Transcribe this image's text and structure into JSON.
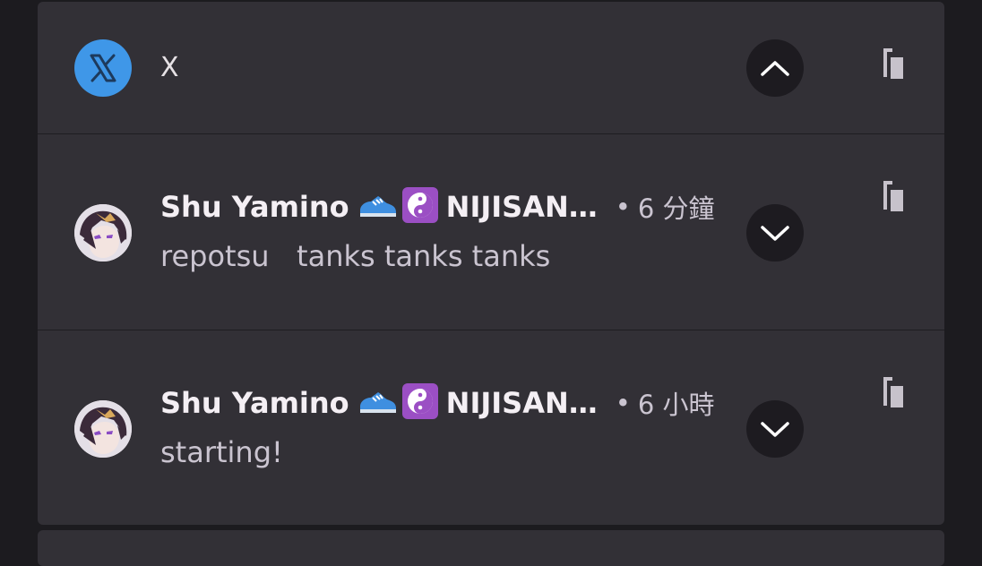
{
  "app": {
    "name": "X",
    "icon": "x-logo-icon",
    "expand_state": "expanded",
    "colors": {
      "icon_bg": "#3f97e8"
    }
  },
  "notifications": [
    {
      "sender": "Shu Yamino",
      "emoji": [
        "running-shoe-icon",
        "yin-yang-icon"
      ],
      "sender_suffix": "NIJISAN…",
      "separator": "•",
      "time": "6 分鐘",
      "message": "repotsu   tanks tanks tanks",
      "avatar": "avatar-icon"
    },
    {
      "sender": "Shu Yamino",
      "emoji": [
        "running-shoe-icon",
        "yin-yang-icon"
      ],
      "sender_suffix": "NIJISAN…",
      "separator": "•",
      "time": "6 小時",
      "message": "starting!",
      "avatar": "avatar-icon"
    }
  ],
  "colors": {
    "background": "#1c1b1f",
    "card": "#323036",
    "button": "#1d1b20"
  }
}
